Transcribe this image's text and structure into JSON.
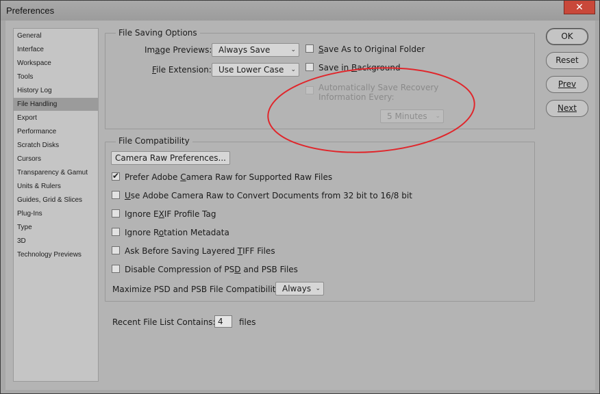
{
  "window": {
    "title": "Preferences",
    "close_glyph": "✕"
  },
  "sidebar": {
    "items": [
      "General",
      "Interface",
      "Workspace",
      "Tools",
      "History Log",
      "File Handling",
      "Export",
      "Performance",
      "Scratch Disks",
      "Cursors",
      "Transparency & Gamut",
      "Units & Rulers",
      "Guides, Grid & Slices",
      "Plug-Ins",
      "Type",
      "3D",
      "Technology Previews"
    ],
    "selected": "File Handling"
  },
  "file_saving": {
    "legend": "File Saving Options",
    "image_previews_label": "Image Previews:",
    "image_previews_value": "Always Save",
    "file_extension_label": "File Extension:",
    "file_extension_value": "Use Lower Case",
    "save_as_original": "Save As to Original Folder",
    "save_in_background": "Save in Background",
    "auto_save_line1": "Automatically Save Recovery",
    "auto_save_line2": "Information Every:",
    "auto_save_interval": "5 Minutes"
  },
  "compat": {
    "legend": "File Compatibility",
    "camera_raw_button": "Camera Raw Preferences...",
    "prefer_camera_raw": "Prefer Adobe Camera Raw for Supported Raw Files",
    "use_camera_raw_convert": "Use Adobe Camera Raw to Convert Documents from 32 bit to 16/8 bit",
    "ignore_exif": "Ignore EXIF Profile Tag",
    "ignore_rotation": "Ignore Rotation Metadata",
    "ask_tiff": "Ask Before Saving Layered TIFF Files",
    "disable_compression": "Disable Compression of PSD and PSB Files",
    "maximize_label": "Maximize PSD and PSB File Compatibility:",
    "maximize_value": "Always"
  },
  "recent": {
    "label": "Recent File List Contains:",
    "value": "4",
    "suffix": "files"
  },
  "buttons": {
    "ok": "OK",
    "reset": "Reset",
    "prev": "Prev",
    "next": "Next"
  },
  "state": {
    "prefer_camera_raw_checked": true
  },
  "colors": {
    "annotation": "#e0262b",
    "selected_bg": "#9b9b9b"
  }
}
